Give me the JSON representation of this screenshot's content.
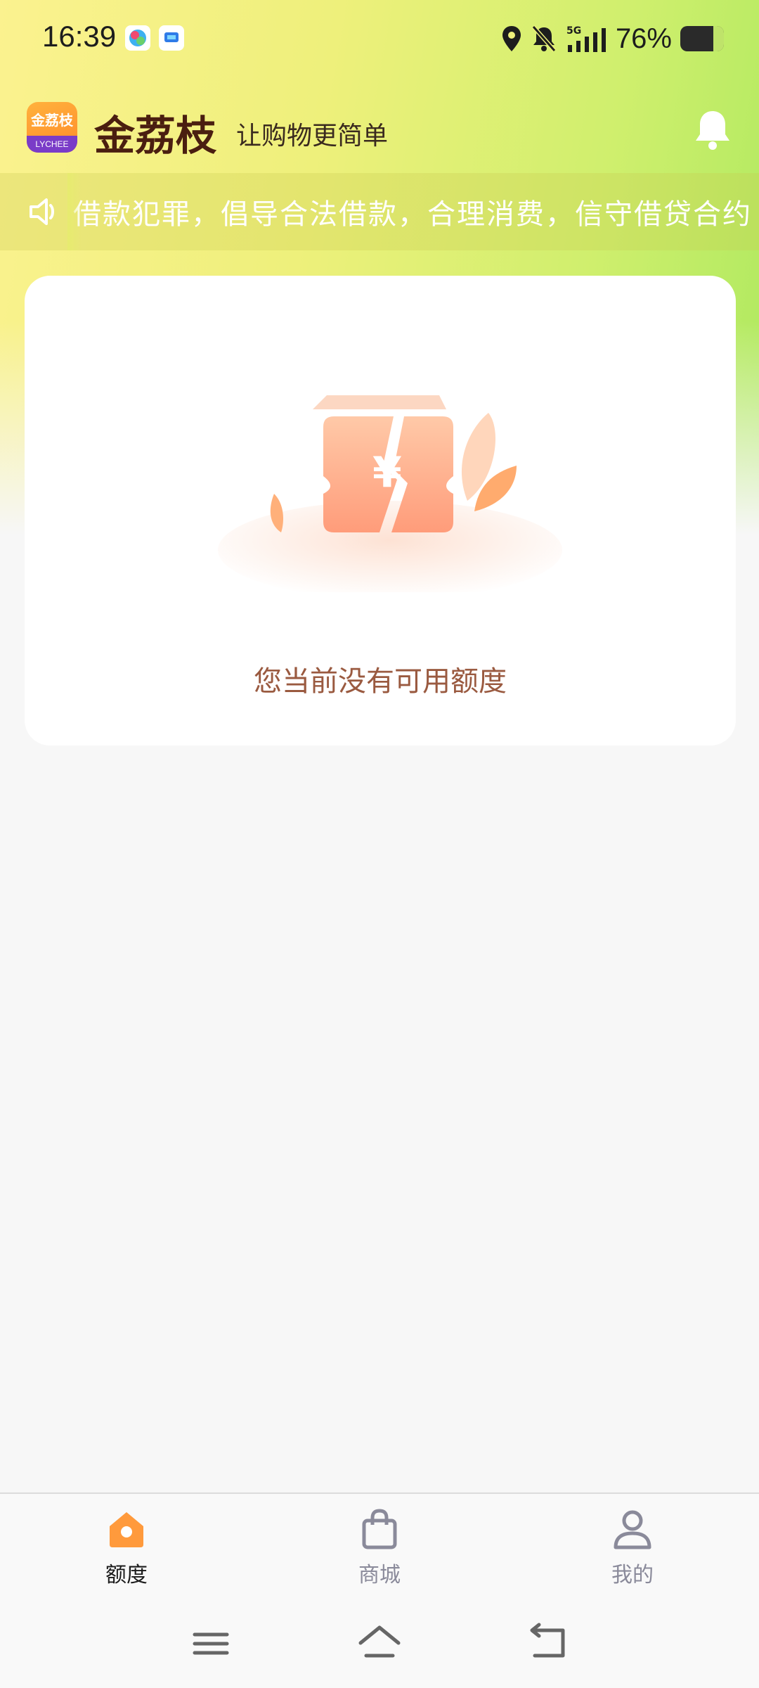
{
  "status_bar": {
    "time": "16:39",
    "battery_percent": "76%",
    "network": "5G",
    "battery_level": 0.76,
    "icons": [
      "location-icon",
      "silent-bell-icon",
      "signal-icon",
      "battery-icon"
    ]
  },
  "header": {
    "app_name": "金荔枝",
    "slogan": "让购物更简单",
    "logo_text": "金荔枝",
    "logo_band_text": "LYCHEE"
  },
  "marquee": {
    "text": "借款犯罪，倡导合法借款，合理消费，信守借贷合约"
  },
  "card": {
    "empty_message": "您当前没有可用额度"
  },
  "tabs": [
    {
      "label": "额度",
      "active": true,
      "icon": "home-icon"
    },
    {
      "label": "商城",
      "active": false,
      "icon": "shopping-bag-icon"
    },
    {
      "label": "我的",
      "active": false,
      "icon": "person-icon"
    }
  ],
  "colors": {
    "accent": "#ff9a3c",
    "header_text": "#4a1e10",
    "empty_text": "#9a5a40",
    "tab_inactive": "#8a8a9a"
  }
}
